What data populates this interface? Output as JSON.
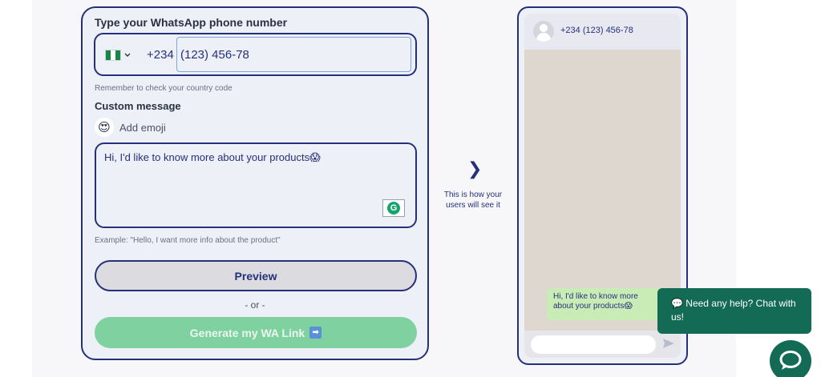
{
  "form": {
    "phone_label": "Type your WhatsApp phone number",
    "country_flag": "nigeria-flag-icon",
    "dial_code": "+234",
    "phone_value": "(123) 456-78",
    "country_hint": "Remember to check your country code",
    "custom_label": "Custom message",
    "add_emoji_label": "Add emoji",
    "emoji_icon": "😍",
    "message_text": "Hi, I'd like to know more about your products😱",
    "example_hint": "Example: \"Hello, I want more info about the product\"",
    "preview_label": "Preview",
    "or_label": "- or -",
    "generate_label": "Generate my WA Link"
  },
  "middle": {
    "arrow": "❯",
    "caption": "This is how your users will see it"
  },
  "preview": {
    "header_phone": "+234 (123) 456-78",
    "bubble_text": "Hi, I'd like to know more about your products😱"
  },
  "help": {
    "tooltip_text": "💬 Need any help? Chat with us!"
  },
  "colors": {
    "accent": "#26307a",
    "whatsapp_green": "#146b55",
    "generate_button": "#7fd1a0",
    "bubble": "#c9ecb6"
  }
}
